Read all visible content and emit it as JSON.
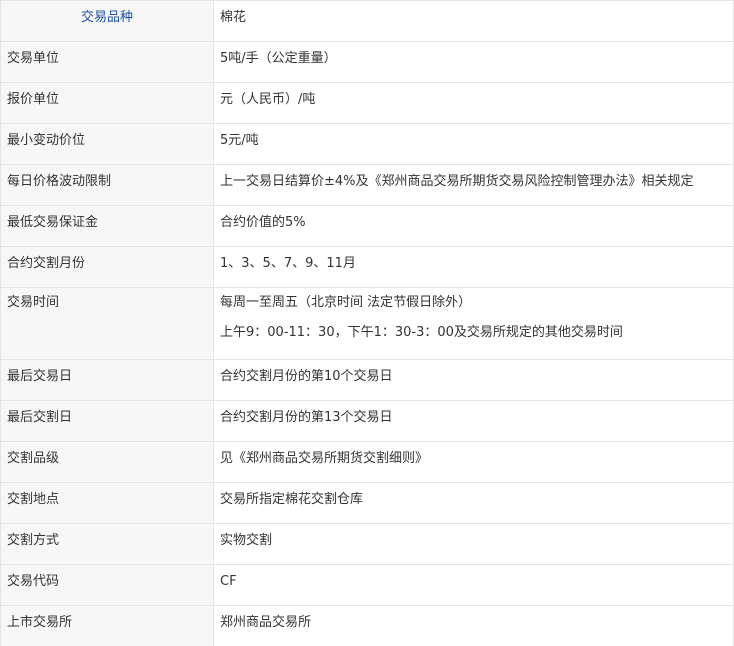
{
  "table": {
    "header": {
      "label": "交易品种",
      "value": "棉花"
    },
    "rows": [
      {
        "label": "交易单位",
        "value": "5吨/手（公定重量）"
      },
      {
        "label": "报价单位",
        "value": "元（人民币）/吨"
      },
      {
        "label": "最小变动价位",
        "value": "5元/吨"
      },
      {
        "label": "每日价格波动限制",
        "value": "上一交易日结算价±4%及《郑州商品交易所期货交易风险控制管理办法》相关规定"
      },
      {
        "label": "最低交易保证金",
        "value": "合约价值的5%"
      },
      {
        "label": "合约交割月份",
        "value": "1、3、5、7、9、11月"
      }
    ],
    "trading_time": {
      "label": "交易时间",
      "line1": "每周一至周五（北京时间 法定节假日除外）",
      "line2": "上午9：00-11：30，下午1：30-3：00及交易所规定的其他交易时间"
    },
    "rows2": [
      {
        "label": "最后交易日",
        "value": "合约交割月份的第10个交易日"
      },
      {
        "label": "最后交割日",
        "value": "合约交割月份的第13个交易日"
      },
      {
        "label": "交割品级",
        "value": "见《郑州商品交易所期货交割细则》"
      },
      {
        "label": "交割地点",
        "value": "交易所指定棉花交割仓库"
      },
      {
        "label": "交割方式",
        "value": "实物交割"
      },
      {
        "label": "交易代码",
        "value": "CF"
      },
      {
        "label": "上市交易所",
        "value": "郑州商品交易所"
      }
    ]
  }
}
